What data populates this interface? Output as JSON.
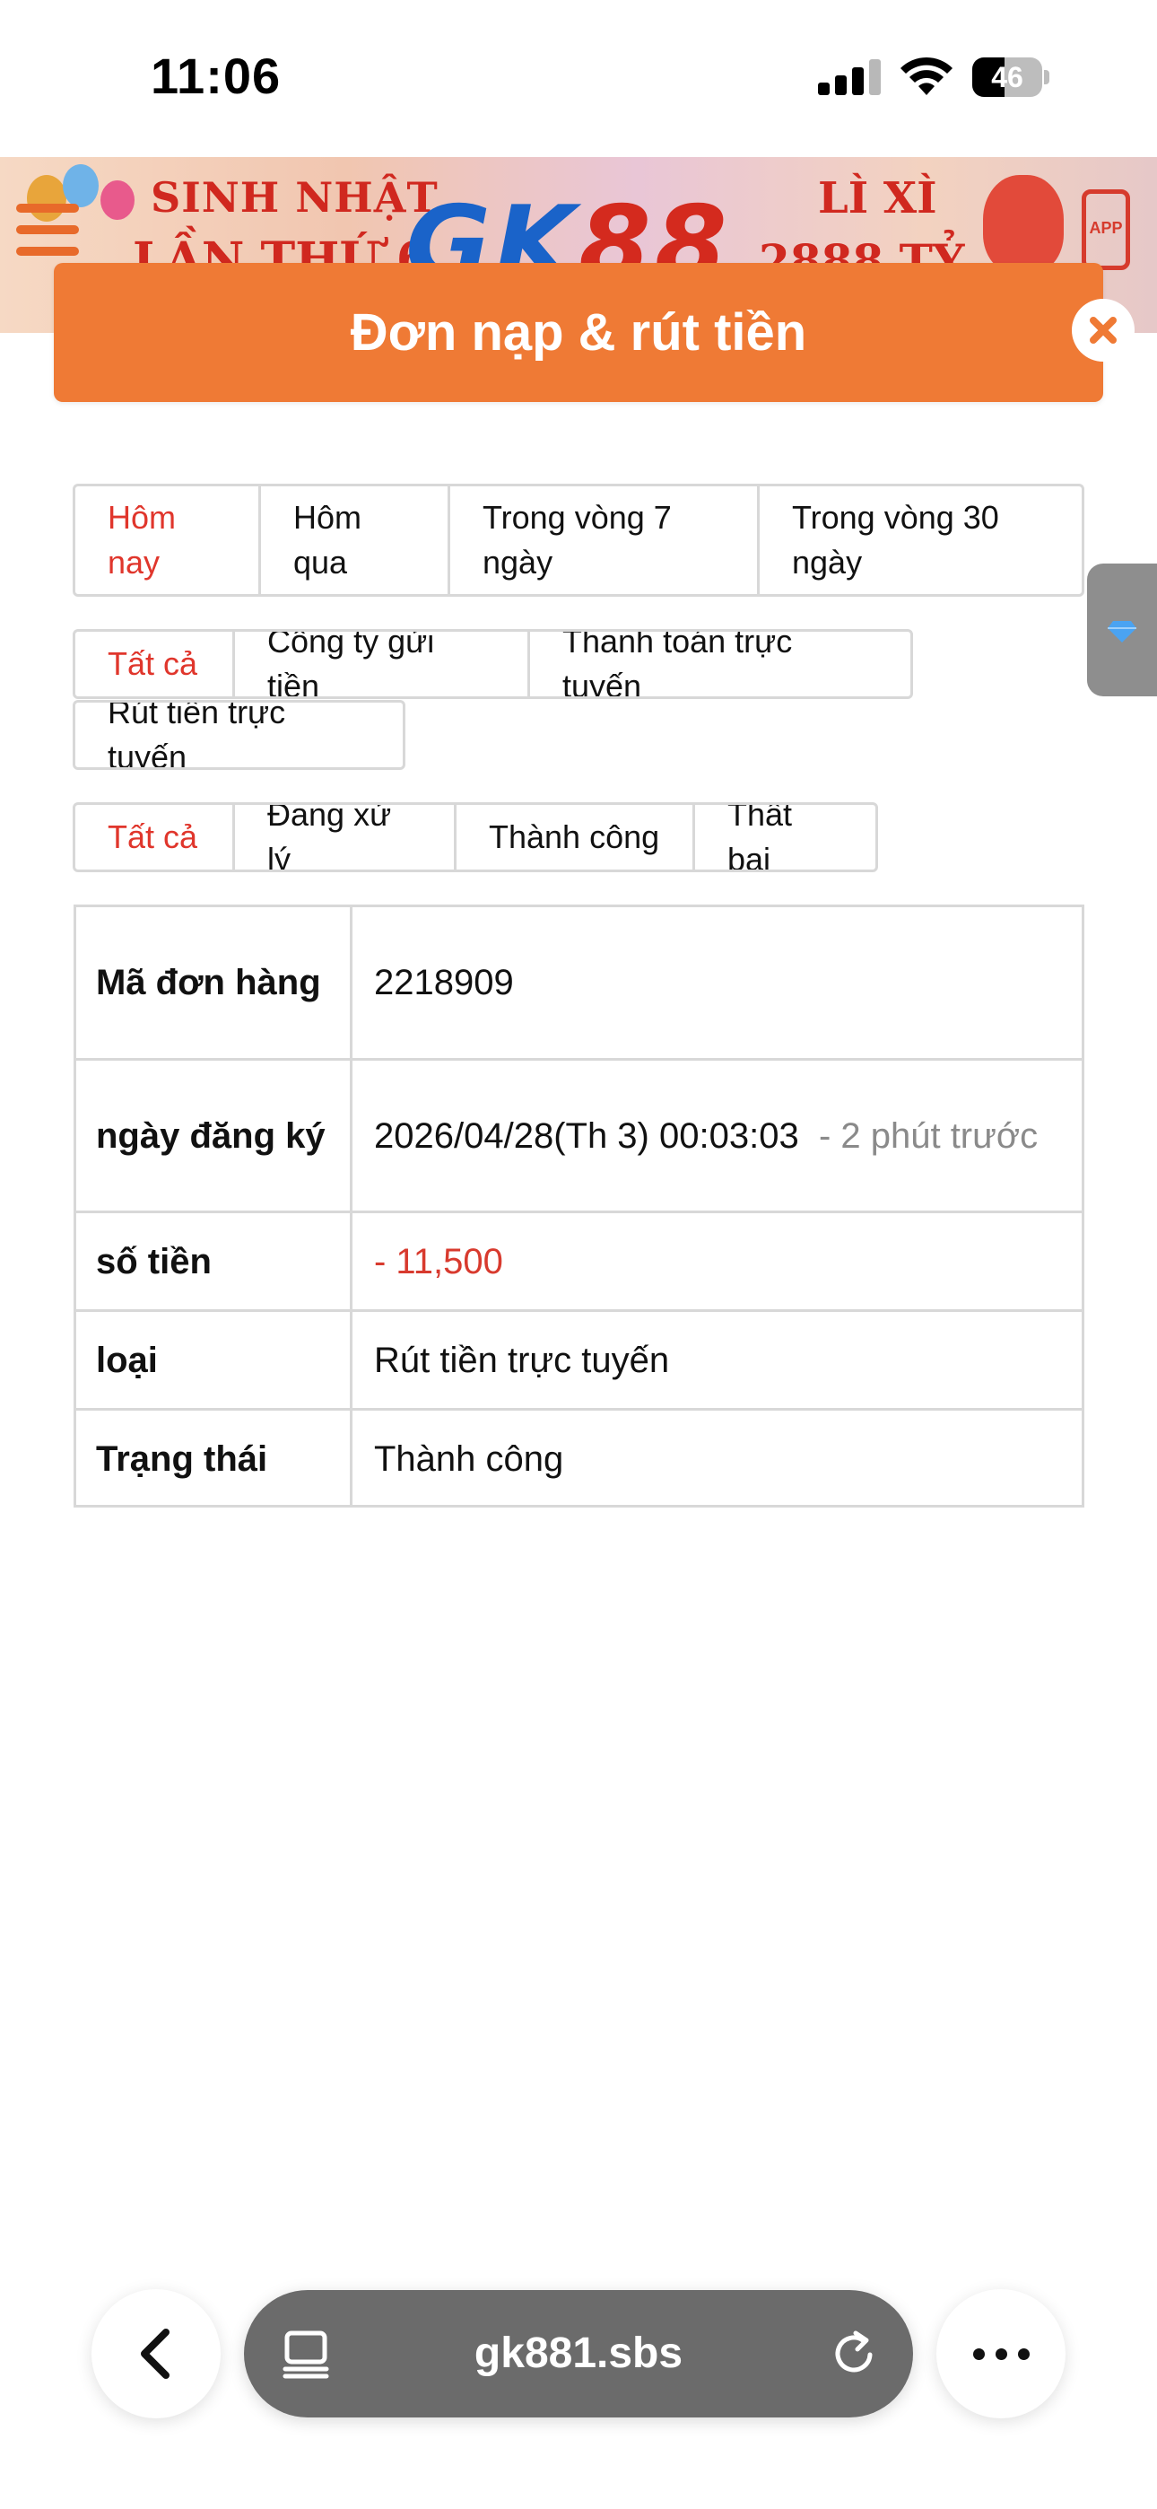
{
  "status_bar": {
    "time": "11:06",
    "battery": "46",
    "battery_level": 0.46
  },
  "banner": {
    "line1": "SINH NHẬT",
    "line2": "LẦN THỨ 6",
    "logo_left": "GK",
    "logo_right": "88",
    "lixi": "LÌ XÌ",
    "lixi_amount": "2888 TỶ",
    "app_label": "APP"
  },
  "modal": {
    "title": "Đơn nạp & rút tiền"
  },
  "date_filter": {
    "options": [
      "Hôm nay",
      "Hôm qua",
      "Trong vòng 7 ngày",
      "Trong vòng 30 ngày"
    ],
    "active": "Hôm nay"
  },
  "type_filter": {
    "options": [
      "Tất cả",
      "Công ty gửi tiền",
      "Thanh toán trực tuyến",
      "Rút tiền trực tuyến"
    ],
    "active": "Tất cả"
  },
  "status_filter": {
    "options": [
      "Tất cả",
      "Đang xử lý",
      "Thành công",
      "Thất bại"
    ],
    "active": "Tất cả"
  },
  "order": {
    "labels": {
      "order_id": "Mã đơn hàng",
      "date": "ngày đăng ký",
      "amount": "số tiền",
      "type": "loại",
      "status": "Trạng thái"
    },
    "order_id": "2218909",
    "date": "2026/04/28(Th 3) 00:03:03",
    "date_relative": "- 2 phút trước",
    "amount": "- 11,500",
    "type": "Rút tiền trực tuyến",
    "status": "Thành công"
  },
  "browser": {
    "url": "gk881.sbs"
  },
  "colors": {
    "accent": "#ef7a35",
    "active_text": "#e0362c",
    "negative": "#d83a2e",
    "muted": "#8a8a8a"
  }
}
